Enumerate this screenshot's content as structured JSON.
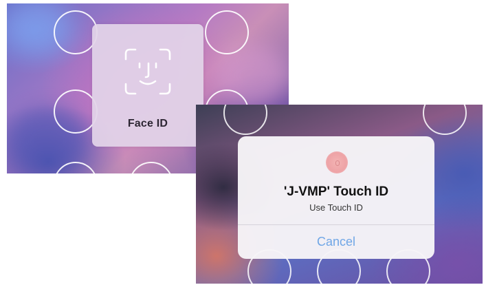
{
  "face_id": {
    "label": "Face ID",
    "icon": "face-id-icon"
  },
  "touch_id": {
    "title": "'J-VMP' Touch ID",
    "subtitle": "Use Touch ID",
    "icon": "fingerprint-icon",
    "cancel_label": "Cancel"
  },
  "colors": {
    "cancel_text": "#6fa6e6",
    "face_card": "#e2d4e8",
    "dialog_bg": "#f6f4f7"
  }
}
